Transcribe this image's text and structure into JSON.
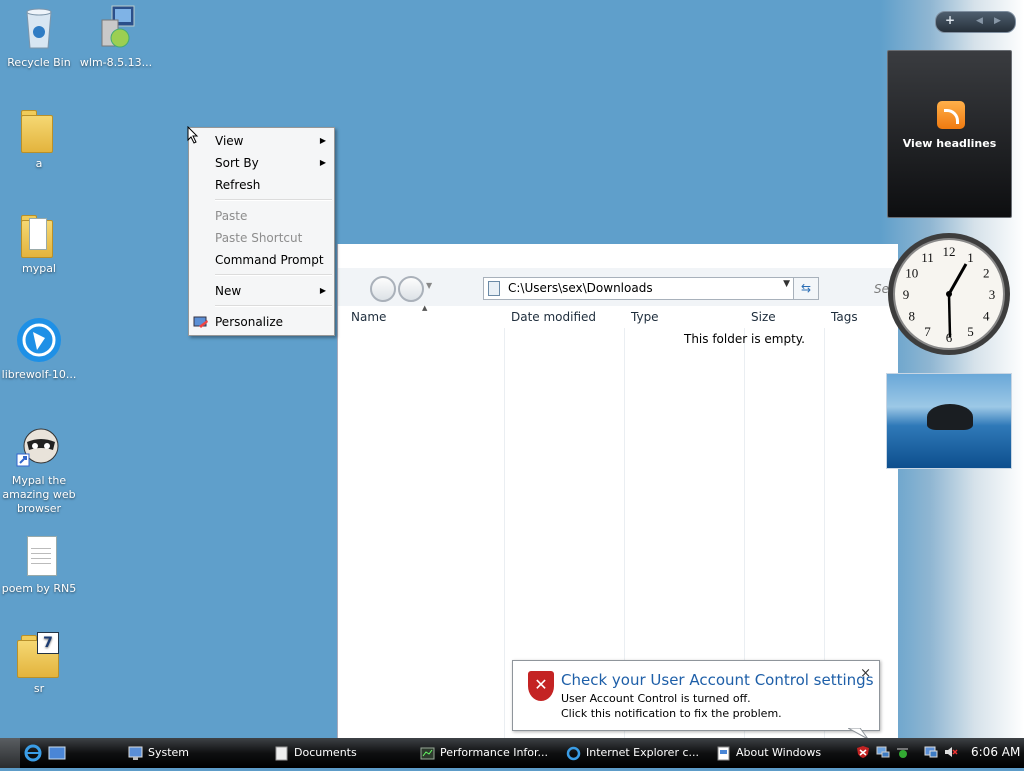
{
  "desktop": {
    "icons": [
      {
        "label": "Recycle Bin",
        "icon": "recycle-bin-icon"
      },
      {
        "label": "wlm-8.5.13...",
        "icon": "installer-icon"
      },
      {
        "label": "a",
        "icon": "folder-icon"
      },
      {
        "label": "mypal",
        "icon": "folder-icon"
      },
      {
        "label": "librewolf-10...",
        "icon": "librewolf-icon"
      },
      {
        "label": "Mypal the amazing web browser",
        "icon": "raccoon-shortcut-icon"
      },
      {
        "label": "poem by RN5",
        "icon": "text-document-icon"
      },
      {
        "label": "sr",
        "icon": "folder-7-icon"
      }
    ]
  },
  "context_menu": {
    "items": [
      {
        "label": "View",
        "submenu": true,
        "enabled": true
      },
      {
        "label": "Sort By",
        "submenu": true,
        "enabled": true
      },
      {
        "label": "Refresh",
        "enabled": true
      },
      {
        "label": "Paste",
        "enabled": false
      },
      {
        "label": "Paste Shortcut",
        "enabled": false
      },
      {
        "label": "Command Prompt",
        "enabled": true
      },
      {
        "label": "New",
        "submenu": true,
        "enabled": true
      },
      {
        "label": "Personalize",
        "enabled": true,
        "icon": "personalize-icon"
      }
    ]
  },
  "explorer": {
    "address": "C:\\Users\\sex\\Downloads",
    "search_hint": "Se",
    "columns": [
      "Name",
      "Date modified",
      "Type",
      "Size",
      "Tags"
    ],
    "empty_message": "This folder is empty."
  },
  "sidebar": {
    "feed_label": "View headlines",
    "clock_numbers": [
      "12",
      "1",
      "2",
      "3",
      "4",
      "5",
      "6",
      "7",
      "8",
      "9",
      "10",
      "11"
    ]
  },
  "uac": {
    "title": "Check your User Account Control settings",
    "line1": "User Account Control is turned off.",
    "line2": "Click this notification to fix the problem.",
    "close": "×"
  },
  "taskbar": {
    "buttons": [
      {
        "label": "System",
        "icon": "system-icon"
      },
      {
        "label": "Documents",
        "icon": "documents-icon"
      },
      {
        "label": "Performance Infor...",
        "icon": "performance-icon"
      },
      {
        "label": "Internet Explorer c...",
        "icon": "internet-explorer-icon"
      },
      {
        "label": "About Windows",
        "icon": "about-icon"
      }
    ],
    "time": "6:06 AM"
  },
  "colors": {
    "desktop": "#5f9fcb",
    "uac_title": "#1e5fa8",
    "taskbar": "#0f1011"
  }
}
